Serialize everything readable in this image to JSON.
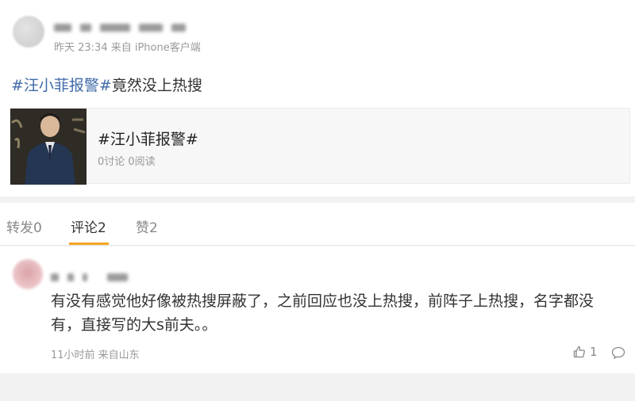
{
  "post": {
    "meta": "昨天 23:34 来自 iPhone客户端",
    "hashtag": "#汪小菲报警#",
    "text": "竟然没上热搜"
  },
  "topic_card": {
    "title": "#汪小菲报警#",
    "stats": "0讨论 0阅读"
  },
  "tabs": [
    {
      "label": "转发0"
    },
    {
      "label": "评论2"
    },
    {
      "label": "赞2"
    }
  ],
  "active_tab": "评论2",
  "accent_color": "#f5a623",
  "link_color": "#3f6aa8",
  "comment": {
    "text": "有没有感觉他好像被热搜屏蔽了，之前回应也没上热搜，前阵子上热搜，名字都没有，直接写的大s前夫。。",
    "meta": "11小时前 来自山东",
    "like_count": "1"
  },
  "icons": [
    "thumb-up-icon",
    "reply-icon"
  ]
}
